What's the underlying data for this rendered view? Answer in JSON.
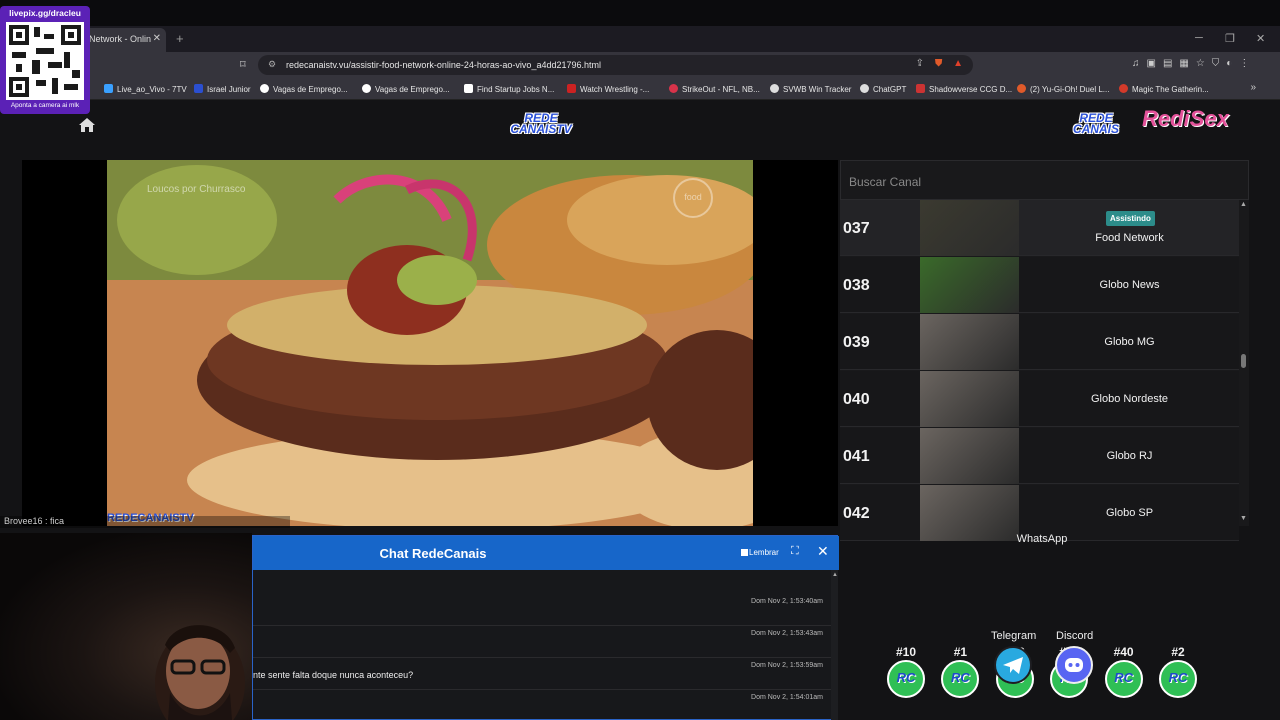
{
  "browser": {
    "tab_title": "Network - Onlin",
    "new_tab": "+",
    "url": "redecanaistv.vu/assistir-food-network-online-24-horas-ao-vivo_a4dd21796.html",
    "bookmarks": [
      {
        "label": "Live_ao_Vivo - 7TV",
        "color": "#3aa0ff"
      },
      {
        "label": "Israel Junior",
        "color": "#2b4fd0"
      },
      {
        "label": "Vagas de Emprego...",
        "color": "#ffffff"
      },
      {
        "label": "Vagas de Emprego...",
        "color": "#ffffff"
      },
      {
        "label": "Find Startup Jobs N...",
        "color": "#ffffff"
      },
      {
        "label": "Watch Wrestling -...",
        "color": "#cc2222"
      },
      {
        "label": "StrikeOut - NFL, NB...",
        "color": "#d8334a"
      },
      {
        "label": "SVWB Win Tracker",
        "color": "#dddddd"
      },
      {
        "label": "ChatGPT",
        "color": "#dddddd"
      },
      {
        "label": "Shadowverse CCG D...",
        "color": "#cc3333"
      },
      {
        "label": "(2) Yu-Gi-Oh! Duel L...",
        "color": "#e05a2a"
      },
      {
        "label": "Magic The Gatherin...",
        "color": "#d33a2a"
      }
    ]
  },
  "overlay": {
    "qr_title": "livepix.gg/dracleu",
    "qr_subtitle": "Aponta a camera ai mlk",
    "chat_line": "Brovee16 : fica"
  },
  "site": {
    "logo_top": "REDE",
    "logo_bottom": "CANAISTV",
    "logo2_top": "REDE",
    "logo2_bottom": "CANAIS",
    "logo3": "RediSex",
    "video": {
      "watermark": "Loucos por Churrasco",
      "corner_logo": "food",
      "bottom_logo": "REDECANAISTV"
    },
    "search_placeholder": "Buscar Canal",
    "channels": [
      {
        "num": "037",
        "name": "Food Network",
        "badge": "Assistindo",
        "active": true,
        "thumb": "#3b3a30"
      },
      {
        "num": "038",
        "name": "Globo News",
        "badge": "",
        "active": false,
        "thumb": "#3a6a2a"
      },
      {
        "num": "039",
        "name": "Globo MG",
        "badge": "",
        "active": false,
        "thumb": "#6b6560"
      },
      {
        "num": "040",
        "name": "Globo Nordeste",
        "badge": "",
        "active": false,
        "thumb": "#6b6560"
      },
      {
        "num": "041",
        "name": "Globo RJ",
        "badge": "",
        "active": false,
        "thumb": "#6b6560"
      },
      {
        "num": "042",
        "name": "Globo SP",
        "badge": "",
        "active": false,
        "thumb": "#6b6560"
      }
    ],
    "chat": {
      "title": "Chat RedeCanais",
      "remember": "Lembrar",
      "messages": [
        {
          "time": "Dom Nov 2, 1:53:40am",
          "text": ""
        },
        {
          "time": "Dom Nov 2, 1:53:43am",
          "text": ""
        },
        {
          "time": "Dom Nov 2, 1:53:59am",
          "text": "nte sente falta doque nunca aconteceu?"
        },
        {
          "time": "Dom Nov 2, 1:54:01am",
          "text": ""
        }
      ]
    },
    "whatsapp": {
      "label": "WhatsApp",
      "groups": [
        "#10",
        "#1",
        "#23",
        "#12",
        "#40",
        "#2"
      ]
    },
    "telegram_label": "Telegram",
    "discord_label": "Discord",
    "colors": {
      "accent": "#1766c9",
      "whatsapp": "#2fbf55",
      "telegram": "#29a9e0",
      "discord": "#5865f2",
      "badge": "#2c8c8a"
    }
  }
}
